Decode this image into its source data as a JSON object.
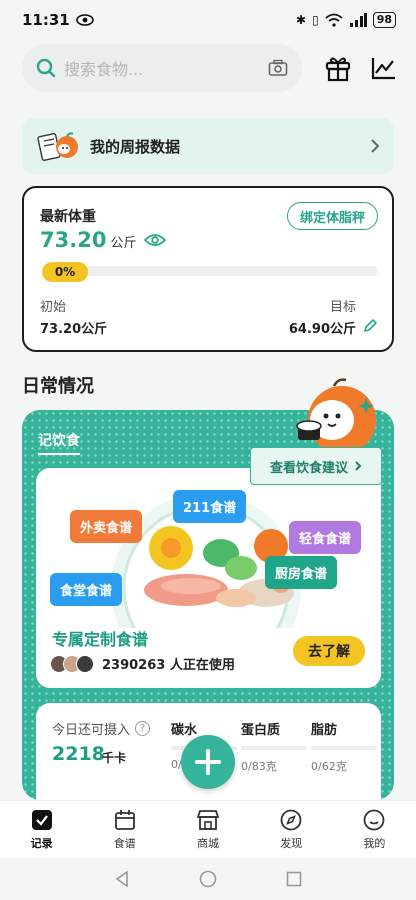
{
  "status_bar": {
    "time": "11:31",
    "battery": "98"
  },
  "search": {
    "placeholder": "搜索食物..."
  },
  "weekly": {
    "label": "我的周报数据"
  },
  "weight": {
    "title": "最新体重",
    "value": "73.20",
    "unit": "公斤",
    "bind_label": "绑定体脂秤",
    "progress_text": "0%",
    "progress_fraction": 0,
    "start_label": "初始",
    "start_value": "73.20公斤",
    "goal_label": "目标",
    "goal_value": "64.90公斤"
  },
  "section_title": "日常情况",
  "diet": {
    "tab": "记饮食",
    "advice_label": "查看饮食建议",
    "bubbles": [
      "外卖食谱",
      "211食谱",
      "轻食食谱",
      "食堂食谱",
      "厨房食谱"
    ],
    "recipe_title": "专属定制食谱",
    "users_text": "2390263 人正在使用",
    "go_label": "去了解"
  },
  "intake": {
    "label": "今日还可摄入",
    "kcal": "2218",
    "kcal_unit": "千卡",
    "macros": [
      {
        "name": "碳水",
        "value": "0/"
      },
      {
        "name": "蛋白质",
        "value": "0/83克"
      },
      {
        "name": "脂肪",
        "value": "0/62克"
      }
    ]
  },
  "nav": {
    "items": [
      {
        "label": "记录",
        "icon": "record-icon"
      },
      {
        "label": "食谱",
        "icon": "calendar-icon"
      },
      {
        "label": "商城",
        "icon": "shop-icon"
      },
      {
        "label": "发现",
        "icon": "compass-icon"
      },
      {
        "label": "我的",
        "icon": "smile-icon"
      }
    ]
  },
  "colors": {
    "accent": "#36b49b",
    "accent_dark": "#2aa58c",
    "yellow": "#f4c520"
  }
}
